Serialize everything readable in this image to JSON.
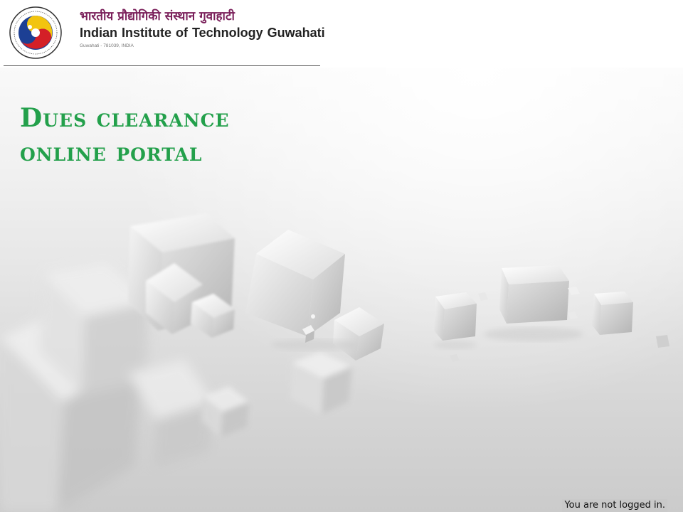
{
  "header": {
    "institute_name_hindi": "भारतीय प्रौद्योगिकी संस्थान गुवाहाटी",
    "institute_name_english": "Indian Institute of Technology  Guwahati",
    "address": "Guwahati - 781039, INDIA",
    "logo_icon": "iitg-logo-icon"
  },
  "hero": {
    "title_line1": "Dues clearance",
    "title_line2": "online portal",
    "title_color": "#23a04b"
  },
  "status": {
    "login_text": "You are not logged in."
  },
  "colors": {
    "title_green": "#23a04b",
    "hindi_name": "#7a1f5a",
    "logo_blue": "#1c3f94",
    "logo_red": "#d42027",
    "logo_yellow": "#f2c40f"
  }
}
